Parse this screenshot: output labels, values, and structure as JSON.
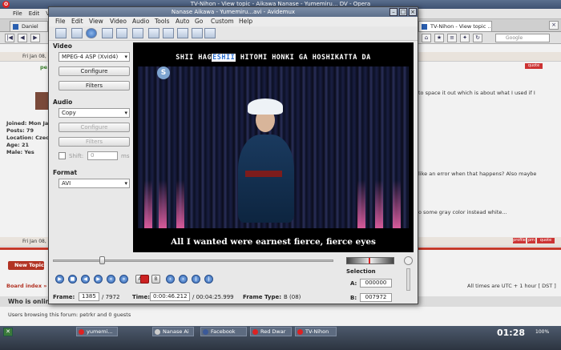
{
  "opera": {
    "title": "TV-Nihon - View topic - Aikawa Nanase - Yumemiru... DV - Opera",
    "menu": [
      "File",
      "Edit",
      "View",
      "B"
    ],
    "tabs": [
      {
        "label": "Daniel"
      },
      {
        "label": "TV-Nihon - View topic ..."
      }
    ],
    "search_placeholder": "Google",
    "posts": [
      {
        "date": "Fri Jan 08,",
        "text": "to space it out which is about what I used if I"
      },
      {
        "date": "Fri Jan 08,",
        "text": ""
      }
    ],
    "user_info": [
      "Joined: Mon Jan 1",
      "Posts: 79",
      "Location: Czech R",
      "Age: 21",
      "Male: Yes"
    ],
    "body_lines": [
      "like an error when that happens? Also maybe",
      "o some gray color instead white..."
    ],
    "new_topic": "New Topic",
    "board_index": "Board index »",
    "times": "All times are UTC + 1 hour [ DST ]",
    "who_online": "Who is online",
    "browsing": "Users browsing this forum: petrkr and 0 guests",
    "badges": [
      "quote",
      "profile",
      "pm",
      "quote"
    ]
  },
  "taskbar": {
    "tasks": [
      "yumemi...",
      "Nanase Ai",
      "Facebook",
      "Red Dwar",
      "TV-Nihon"
    ],
    "clock": "01:28",
    "zoom": "100%"
  },
  "avidemux": {
    "title": "Nanase Aikawa - Yumemiru...avi - Avidemux",
    "menu": [
      "File",
      "Edit",
      "View",
      "Video",
      "Audio",
      "Tools",
      "Auto",
      "Go",
      "Custom",
      "Help"
    ],
    "video_label": "Video",
    "video_codec": "MPEG-4 ASP (Xvid4)",
    "configure": "Configure",
    "filters": "Filters",
    "audio_label": "Audio",
    "audio_codec": "Copy",
    "audio_configure": "Configure",
    "audio_filters": "Filters",
    "shift_label": "Shift:",
    "shift_value": "0",
    "shift_unit": "ms",
    "format_label": "Format",
    "format_value": "AVI",
    "karaoke_prefix": "SHII HAG",
    "karaoke_highlight": "ESHII",
    "karaoke_rest": " HITOMI HONKI GA HOSHIKATTA DA",
    "subtitle": "All I wanted were earnest fierce, fierce eyes",
    "frame_label": "Frame:",
    "frame_value": "1385",
    "frame_total": "/ 7972",
    "time_label": "Time:",
    "time_value": "0:00:46.212",
    "time_total": "/ 00:04:25.999",
    "frame_type_label": "Frame Type:",
    "frame_type_value": "B (08)",
    "selection_label": "Selection",
    "sel_a_label": "A:",
    "sel_a_value": "000000",
    "sel_b_label": "B:",
    "sel_b_value": "007972",
    "position_fraction": 0.174
  }
}
